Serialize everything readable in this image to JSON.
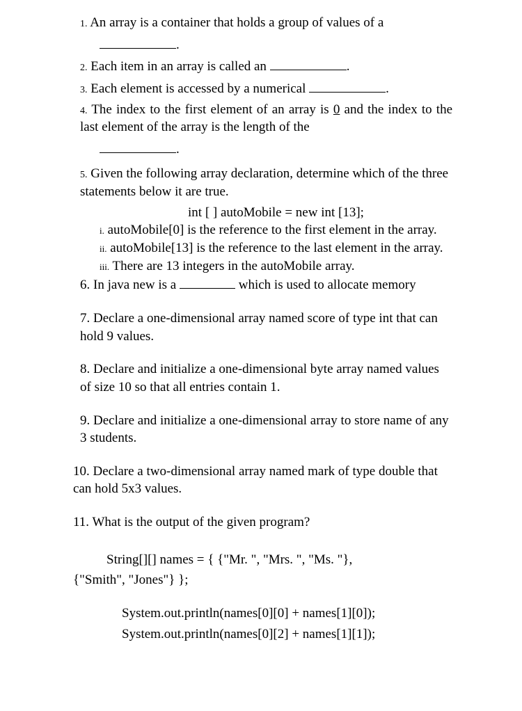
{
  "q1": {
    "num": "1.",
    "text_a": "An array is a container that holds a group of values of a",
    "text_b": "."
  },
  "q2": {
    "num": "2.",
    "text_a": "Each item in an array is called an ",
    "text_b": "."
  },
  "q3": {
    "num": "3.",
    "text_a": "Each element is accessed by a numerical ",
    "text_b": "."
  },
  "q4": {
    "num": "4.",
    "text_a": "The index to the first element of an array is ",
    "zero": "0",
    "text_b": " and the index to the last element of the array is the length of the ",
    "text_c": "."
  },
  "q5": {
    "num": "5.",
    "intro": "Given the following array declaration, determine which of the three statements below it are true.",
    "decl": "int [ ] autoMobile = new int [13];",
    "i_num": "i.",
    "i_text": "autoMobile[0] is the reference to the first element in the array.",
    "ii_num": "ii.",
    "ii_text": "autoMobile[13] is the reference to the last element in the array.",
    "iii_num": "iii.",
    "iii_text": "There are 13 integers in the autoMobile array."
  },
  "q6": {
    "num": "6.",
    "text_a": "In java new is a ",
    "text_b": " which is used to allocate memory"
  },
  "q7": {
    "num": "7.",
    "text": "Declare a one-dimensional array named score of type int that can hold 9 values."
  },
  "q8": {
    "num": "8.",
    "text": "Declare and initialize a one-dimensional byte array named values of size 10 so that all entries contain 1."
  },
  "q9": {
    "num": "9.",
    "text": "Declare and initialize a one-dimensional array to store name of any 3 students."
  },
  "q10": {
    "num": "10.",
    "text": "Declare a two-dimensional array named mark of type double that can hold 5x3 values."
  },
  "q11": {
    "num": "11.",
    "text": "What is the output of the given program?",
    "code1": "String[][] names = { {\"Mr. \", \"Mrs. \", \"Ms. \"},",
    "code2": "{\"Smith\", \"Jones\"} };",
    "code3": "System.out.println(names[0][0] + names[1][0]);",
    "code4": "System.out.println(names[0][2] + names[1][1]);"
  }
}
